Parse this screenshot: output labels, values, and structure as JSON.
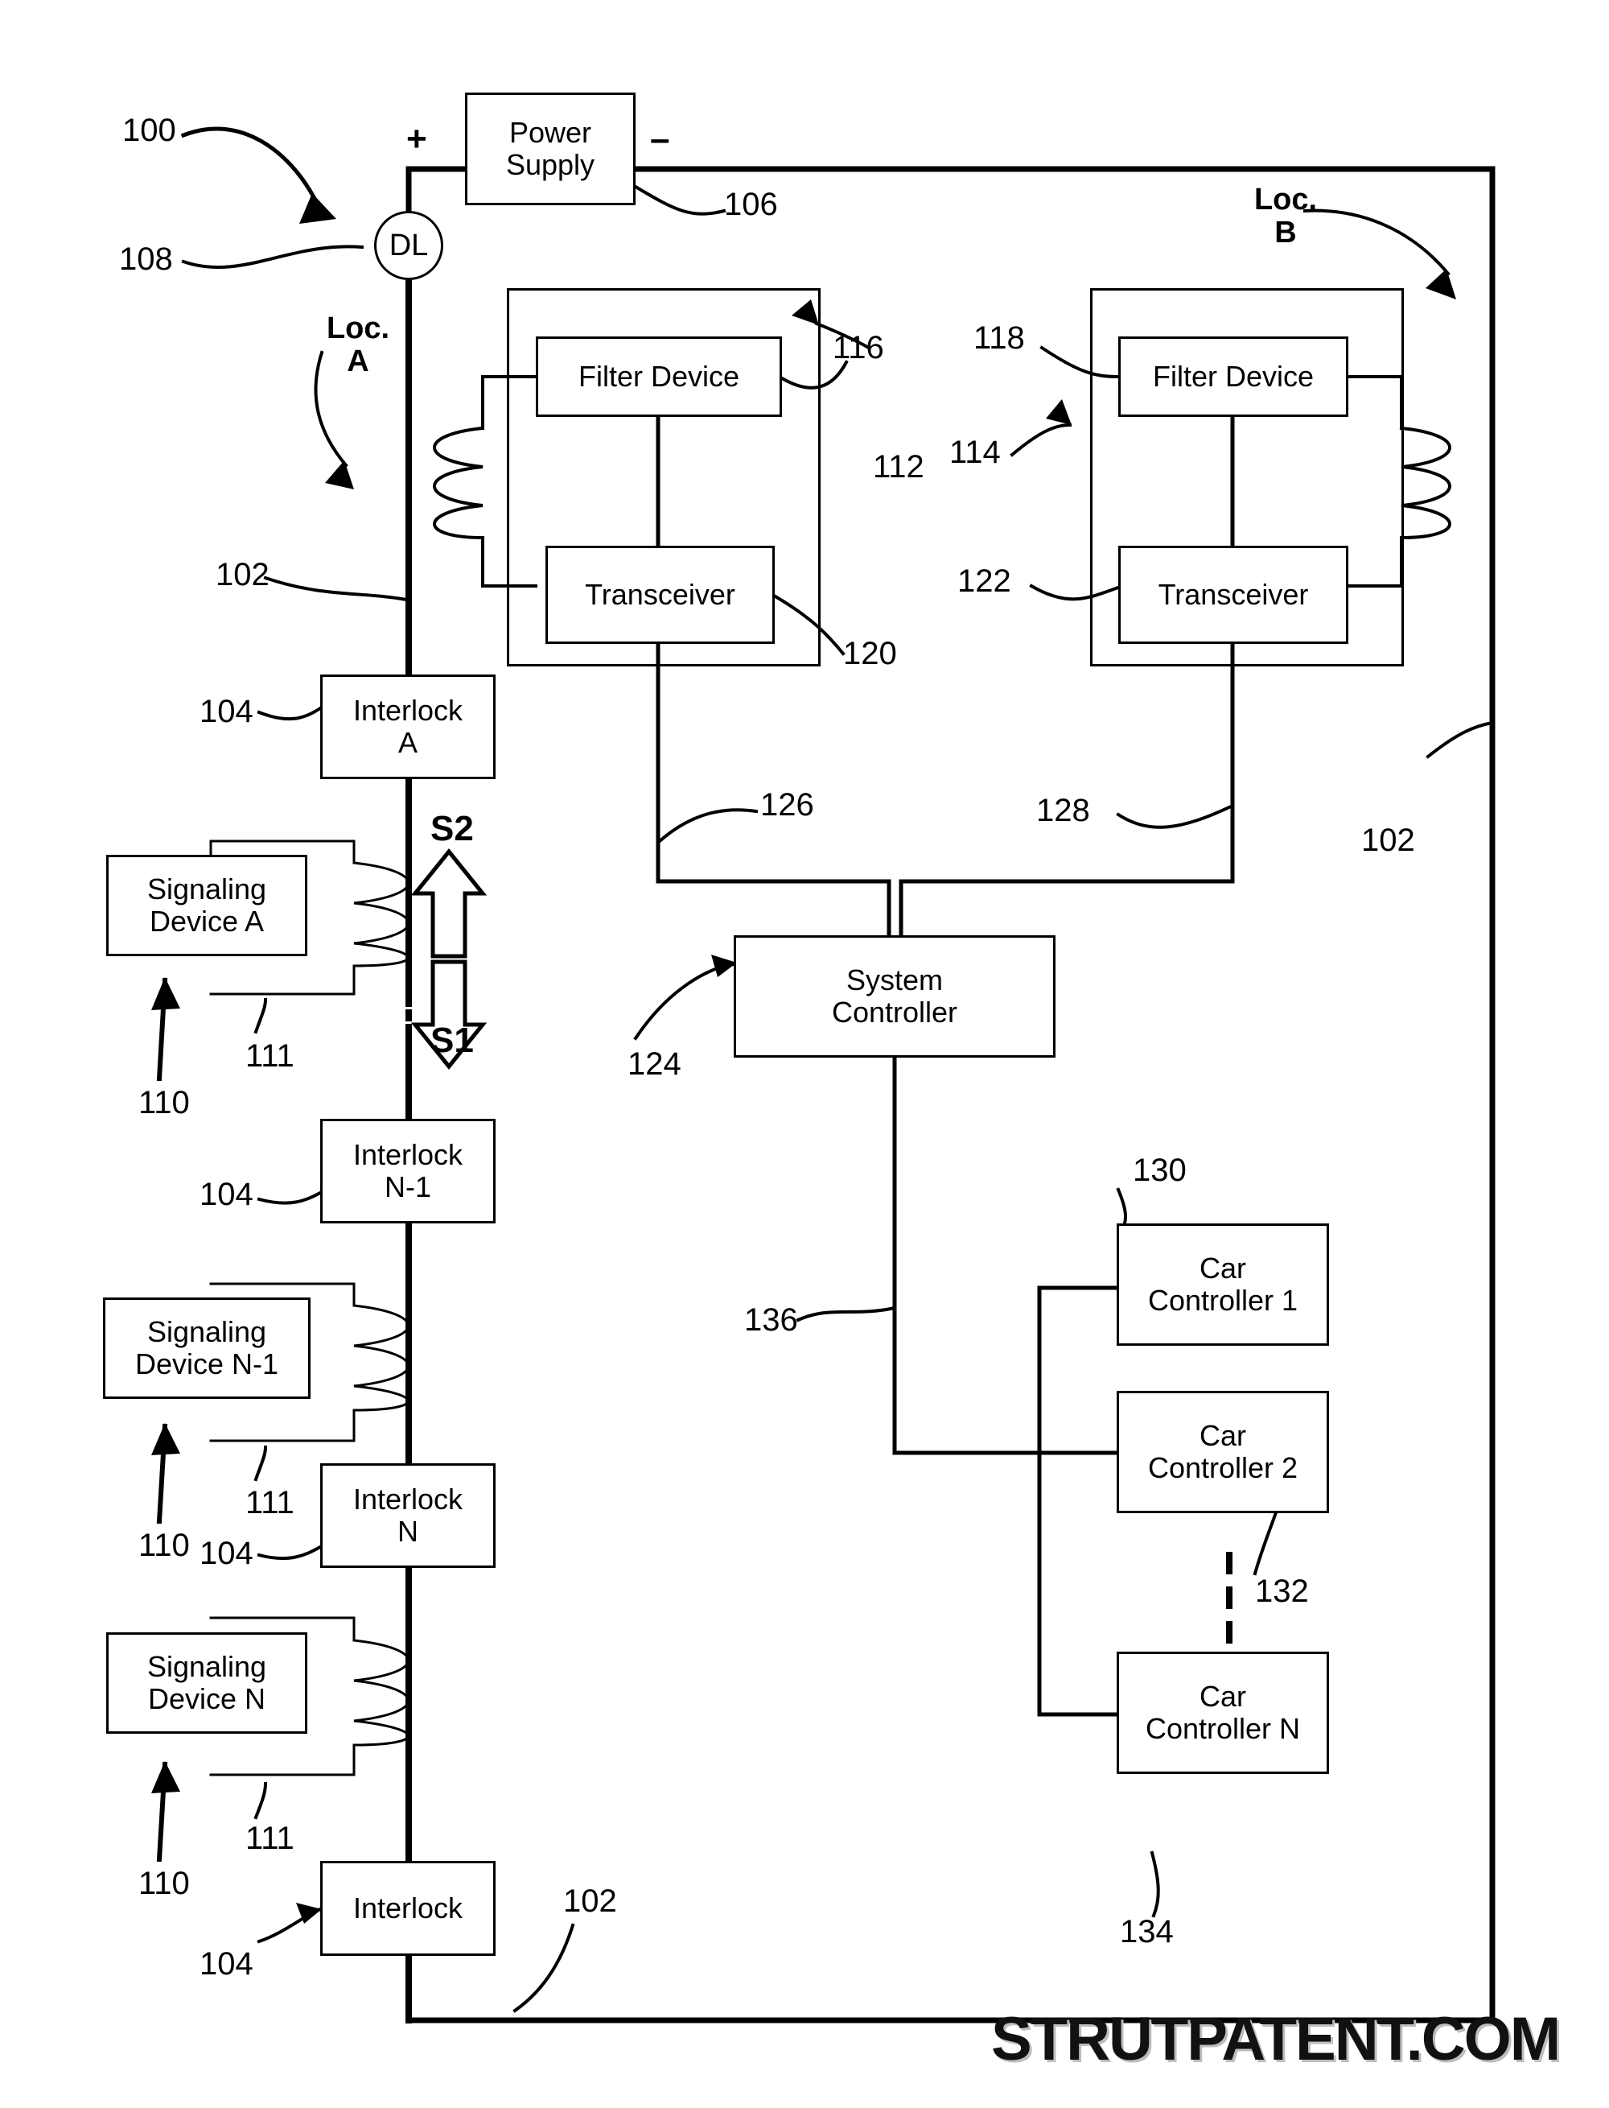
{
  "figure": {
    "title_ref": "100",
    "watermark": "STRUTPATENT.COM"
  },
  "blocks": {
    "power_supply": "Power\nSupply",
    "dl": "DL",
    "filter_a": "Filter Device",
    "transceiver_a": "Transceiver",
    "filter_b": "Filter Device",
    "transceiver_b": "Transceiver",
    "interlock_a": "Interlock\nA",
    "interlock_n1": "Interlock\nN-1",
    "interlock_n": "Interlock\nN",
    "interlock_last": "Interlock",
    "signaling_a": "Signaling\nDevice A",
    "signaling_n1": "Signaling\nDevice N-1",
    "signaling_n": "Signaling\nDevice N",
    "system_controller": "System\nController",
    "car_controller_1": "Car\nController 1",
    "car_controller_2": "Car\nController 2",
    "car_controller_n": "Car\nController N"
  },
  "labels": {
    "loc_a": "Loc.\nA",
    "loc_b": "Loc.\nB",
    "plus": "+",
    "minus": "–",
    "s2": "S2",
    "s1": "S1"
  },
  "refs": {
    "r100": "100",
    "r102_top": "102",
    "r102_right": "102",
    "r102_bottom": "102",
    "r104_a": "104",
    "r104_n1": "104",
    "r104_n": "104",
    "r104_last": "104",
    "r106": "106",
    "r108": "108",
    "r110_a": "110",
    "r110_n1": "110",
    "r110_n": "110",
    "r111_a": "111",
    "r111_n1": "111",
    "r111_n": "111",
    "r112": "112",
    "r114": "114",
    "r116": "116",
    "r118": "118",
    "r120": "120",
    "r122": "122",
    "r124": "124",
    "r126": "126",
    "r128": "128",
    "r130": "130",
    "r132": "132",
    "r134": "134",
    "r136": "136"
  }
}
